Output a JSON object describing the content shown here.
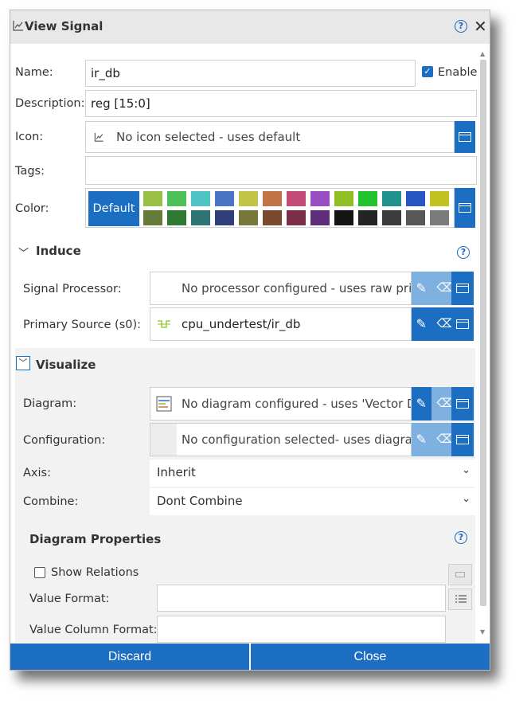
{
  "dialog": {
    "title": "View Signal",
    "icon": "line-chart-icon"
  },
  "fields": {
    "name_label": "Name:",
    "name_value": "ir_db",
    "enable_label": "Enable",
    "enable_checked": true,
    "description_label": "Description:",
    "description_value": "reg [15:0]",
    "icon_label": "Icon:",
    "icon_value": "No icon selected - uses default",
    "tags_label": "Tags:",
    "tags_value": "",
    "color_label": "Color:",
    "color_default_label": "Default",
    "color_swatches_row1": [
      "#9abf45",
      "#4cc15a",
      "#4ec4c4",
      "#4a74c4",
      "#c2c44a",
      "#c27448",
      "#c44a78",
      "#9a4ec4",
      "#8fbf22",
      "#22c22e",
      "#21938f",
      "#2a56c3",
      "#c2c222"
    ],
    "color_swatches_row2": [
      "#667a3c",
      "#2e7a32",
      "#2f7475",
      "#2e3f7a",
      "#77773a",
      "#7a4a2e",
      "#7a2e47",
      "#5e2e7a",
      "#141414",
      "#242424",
      "#3c3c3c",
      "#575757",
      "#7a7a7a"
    ]
  },
  "induce": {
    "title": "Induce",
    "signal_processor_label": "Signal Processor:",
    "signal_processor_value": "No processor configured - uses raw prim",
    "primary_source_label": "Primary Source (s0):",
    "primary_source_value": "cpu_undertest/ir_db"
  },
  "visualize": {
    "title": "Visualize",
    "diagram_label": "Diagram:",
    "diagram_value": "No diagram configured - uses 'Vector Di",
    "configuration_label": "Configuration:",
    "configuration_value": "No configuration selected- uses diagran",
    "axis_label": "Axis:",
    "axis_value": "Inherit",
    "combine_label": "Combine:",
    "combine_value": "Dont Combine"
  },
  "diagram_properties": {
    "title": "Diagram Properties",
    "show_relations_label": "Show Relations",
    "value_format_label": "Value Format:",
    "value_format_value": "",
    "value_column_format_label": "Value Column Format:",
    "value_column_format_value": ""
  },
  "footer": {
    "discard_label": "Discard",
    "close_label": "Close"
  },
  "colors": {
    "accent": "#1b6ec2",
    "accent_light": "#7fb1e0",
    "titlebar": "#e8e8e8",
    "panel": "#f2f2f2"
  }
}
